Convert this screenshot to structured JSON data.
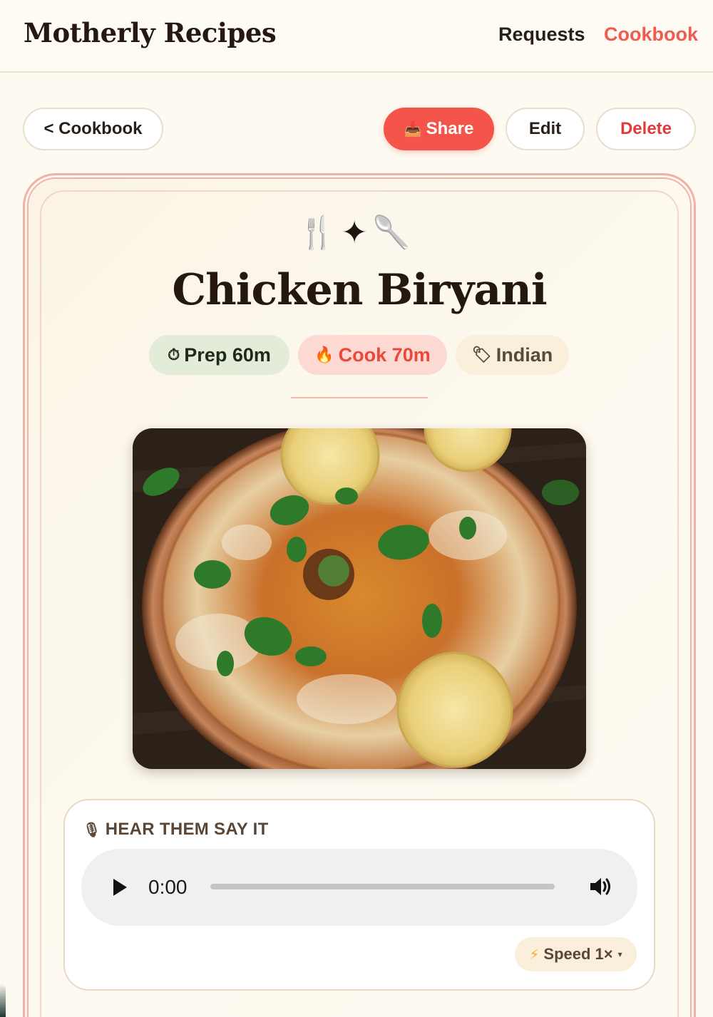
{
  "header": {
    "brand": "Motherly Recipes",
    "nav": {
      "requests": "Requests",
      "cookbook": "Cookbook"
    }
  },
  "toolbar": {
    "back_label": "< Cookbook",
    "share_label": "Share",
    "share_icon": "inbox-tray-icon",
    "edit_label": "Edit",
    "delete_label": "Delete"
  },
  "recipe": {
    "decoration": {
      "left": "🍴",
      "middle": "✦",
      "right": "🥄"
    },
    "title": "Chicken Biryani",
    "chips": {
      "prep": {
        "icon": "⏱",
        "label": "Prep 60m"
      },
      "cook": {
        "icon": "🔥",
        "label": "Cook 70m"
      },
      "cuisine": {
        "icon": "🏷",
        "label": "Indian"
      }
    },
    "photo_alt": "Chicken biryani in a copper bowl with lemon slices and mint leaves"
  },
  "audio": {
    "icon": "🎙",
    "label": "HEAR THEM SAY IT",
    "time": "0:00",
    "progress": 0,
    "speed_icon": "⚡",
    "speed_label": "Speed 1×",
    "speed_caret": "▾"
  },
  "colors": {
    "accent": "#f5544a",
    "background": "#fdfaf1",
    "card_border": "#f3b0a5",
    "delete": "#e23b3b"
  }
}
